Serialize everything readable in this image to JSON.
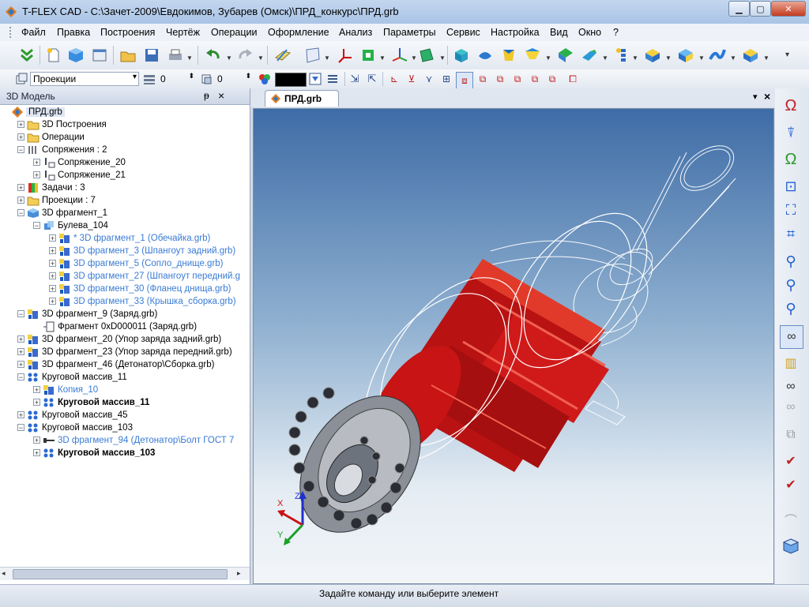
{
  "window": {
    "title": "T-FLEX CAD - C:\\Зачет-2009\\Евдокимов, Зубарев (Омск)\\ПРД_конкурс\\ПРД.grb"
  },
  "menu": [
    "Файл",
    "Правка",
    "Построения",
    "Чертёж",
    "Операции",
    "Оформление",
    "Анализ",
    "Параметры",
    "Сервис",
    "Настройка",
    "Вид",
    "Окно",
    "?"
  ],
  "toolbar2": {
    "view_select": "Проекции",
    "value_a": "0",
    "value_b": "0"
  },
  "panel": {
    "title": "3D Модель",
    "pin": "ᵽ",
    "close": "×"
  },
  "tree": [
    {
      "label": "ПРД.grb",
      "style": "normal",
      "icon": "model-icon"
    },
    {
      "label": "3D Построения",
      "style": "normal",
      "icon": "folder-icon"
    },
    {
      "label": "Операции",
      "style": "normal",
      "icon": "folder-icon"
    },
    {
      "label": "Сопряжения : 2",
      "style": "normal",
      "icon": "constraint-icon"
    },
    {
      "label": "Сопряжение_20",
      "style": "normal",
      "icon": "constraint-item-icon"
    },
    {
      "label": "Сопряжение_21",
      "style": "normal",
      "icon": "constraint-item-icon"
    },
    {
      "label": "Задачи : 3",
      "style": "normal",
      "icon": "tasks-icon"
    },
    {
      "label": "Проекции : 7",
      "style": "normal",
      "icon": "folder-icon"
    },
    {
      "label": "3D фрагмент_1",
      "style": "normal",
      "icon": "fragment-icon"
    },
    {
      "label": "Булева_104",
      "style": "normal",
      "icon": "boolean-icon"
    },
    {
      "label": "* 3D фрагмент_1 (Обечайка.grb)",
      "style": "blue",
      "icon": "fragment-ref-icon"
    },
    {
      "label": "3D фрагмент_3 (Шпангоут задний.grb)",
      "style": "blue",
      "icon": "fragment-ref-icon"
    },
    {
      "label": "3D фрагмент_5 (Сопло_днище.grb)",
      "style": "blue",
      "icon": "fragment-ref-icon"
    },
    {
      "label": "3D фрагмент_27 (Шпангоут передний.g",
      "style": "blue",
      "icon": "fragment-ref-icon"
    },
    {
      "label": "3D фрагмент_30 (Фланец днища.grb)",
      "style": "blue",
      "icon": "fragment-ref-icon"
    },
    {
      "label": "3D фрагмент_33 (Крышка_сборка.grb)",
      "style": "blue",
      "icon": "fragment-ref-icon"
    },
    {
      "label": "3D фрагмент_9 (Заряд.grb)",
      "style": "normal",
      "icon": "fragment-ref-icon"
    },
    {
      "label": "Фрагмент 0xD000011 (Заряд.grb)",
      "style": "normal",
      "icon": "fragment-2d-icon"
    },
    {
      "label": "3D фрагмент_20 (Упор заряда задний.grb)",
      "style": "normal",
      "icon": "fragment-ref-icon"
    },
    {
      "label": "3D фрагмент_23 (Упор заряда передний.grb)",
      "style": "normal",
      "icon": "fragment-ref-icon"
    },
    {
      "label": "3D фрагмент_46 (Детонатор\\Сборка.grb)",
      "style": "normal",
      "icon": "fragment-ref-icon"
    },
    {
      "label": "Круговой массив_11",
      "style": "normal",
      "icon": "array-icon"
    },
    {
      "label": "Копия_10",
      "style": "blue",
      "icon": "fragment-ref-icon"
    },
    {
      "label": "Круговой массив_11",
      "style": "bold",
      "icon": "array-icon"
    },
    {
      "label": "Круговой массив_45",
      "style": "normal",
      "icon": "array-icon"
    },
    {
      "label": "Круговой массив_103",
      "style": "normal",
      "icon": "array-icon"
    },
    {
      "label": "3D фрагмент_94 (Детонатор\\Болт ГОСТ 7",
      "style": "blue",
      "icon": "bolt-icon"
    },
    {
      "label": "Круговой массив_103",
      "style": "bold",
      "icon": "array-icon"
    }
  ],
  "doc_tab": {
    "label": "ПРД.grb",
    "close": "×",
    "menu": "▾"
  },
  "axes": {
    "x": "X",
    "y": "Y",
    "z": "Z"
  },
  "status": {
    "text": "Задайте команду или выберите элемент"
  },
  "colors": {
    "accent": "#1f4fa0",
    "charge_red": "#c81414",
    "viewport_top": "#3e6ca6"
  }
}
